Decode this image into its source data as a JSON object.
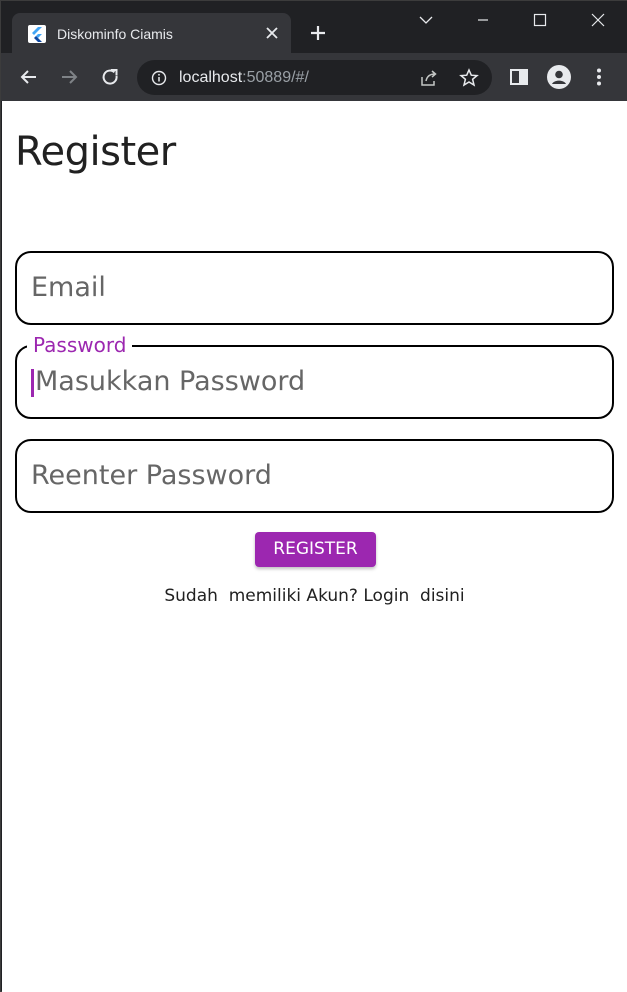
{
  "browser": {
    "tab_title": "Diskominfo Ciamis",
    "url_host": "localhost",
    "url_rest": ":50889/#/",
    "accent_color": "#9c27b0"
  },
  "page": {
    "title": "Register",
    "email_placeholder": "Email",
    "password_label": "Password",
    "password_placeholder": "Masukkan Password",
    "reenter_placeholder": "Reenter Password",
    "register_button": "REGISTER",
    "login_prompt": "Sudah  memiliki Akun? ",
    "login_link": "Login  disini"
  },
  "icons": [
    "flutter-icon",
    "close-icon",
    "plus-icon",
    "chevron-down-icon",
    "minimize-icon",
    "maximize-icon",
    "window-close-icon",
    "back-arrow-icon",
    "forward-arrow-icon",
    "reload-icon",
    "info-icon",
    "share-icon",
    "star-icon",
    "side-panel-icon",
    "profile-icon",
    "more-icon"
  ]
}
